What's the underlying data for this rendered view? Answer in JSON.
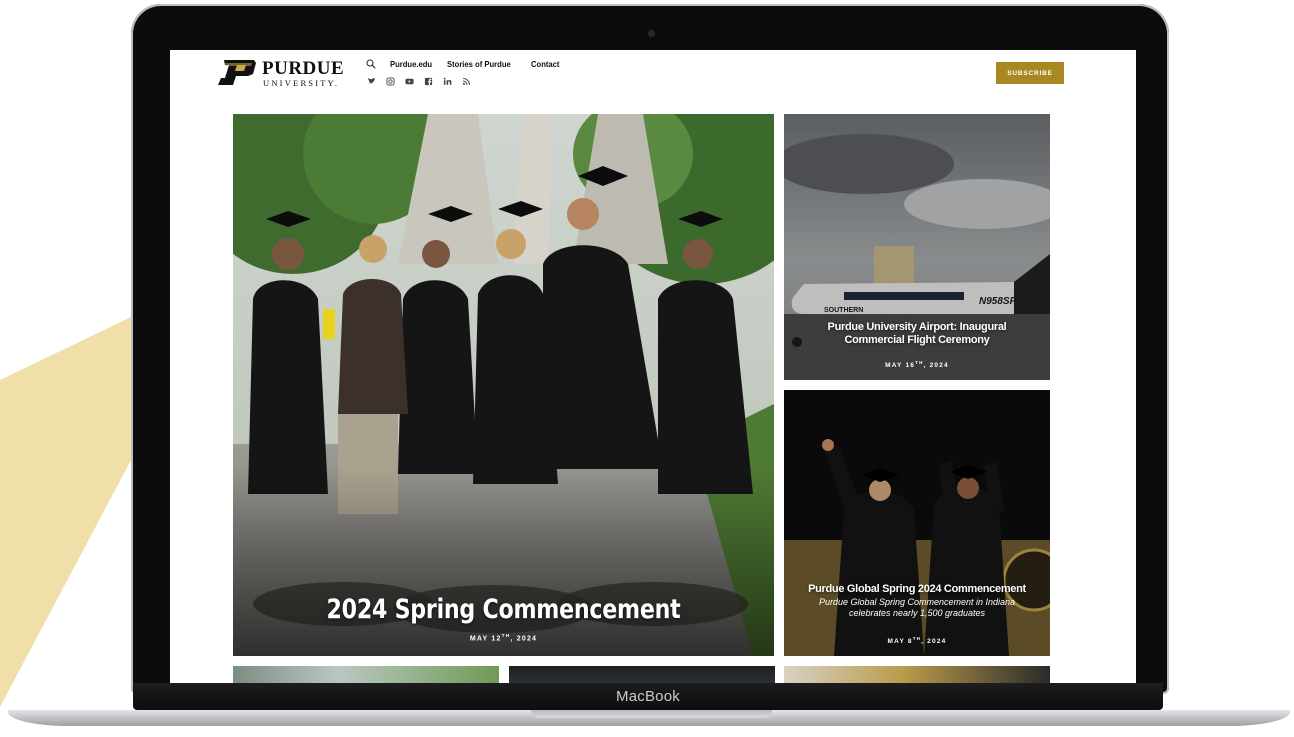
{
  "header": {
    "logo_word": "PURDUE",
    "logo_sub": "UNIVERSITY.",
    "nav": [
      "Purdue.edu",
      "Stories of Purdue",
      "Contact"
    ],
    "social_icons": [
      "twitter-icon",
      "instagram-icon",
      "youtube-icon",
      "facebook-icon",
      "linkedin-icon",
      "rss-icon"
    ],
    "subscribe_label": "SUBSCRIBE"
  },
  "featured": {
    "title": "2024 Spring Commencement",
    "date_main": "MAY 12",
    "date_sup": "TH",
    "date_year": ", 2024"
  },
  "side_cards": [
    {
      "title": "Purdue University Airport: Inaugural Commercial Flight Ceremony",
      "date_main": "MAY 16",
      "date_sup": "TH",
      "date_year": ", 2024",
      "plane_tail": "N958SP",
      "plane_brand": "SOUTHERN"
    },
    {
      "title": "Purdue Global Spring 2024 Commencement",
      "description": "Purdue Global Spring Commencement in Indiana celebrates nearly 1,500 graduates",
      "date_main": "MAY 8",
      "date_sup": "TH",
      "date_year": ", 2024"
    }
  ],
  "device": {
    "brand": "MacBook"
  },
  "colors": {
    "gold": "#a98721",
    "beam": "#f1dfa6",
    "frame": "#0c0c0e"
  }
}
